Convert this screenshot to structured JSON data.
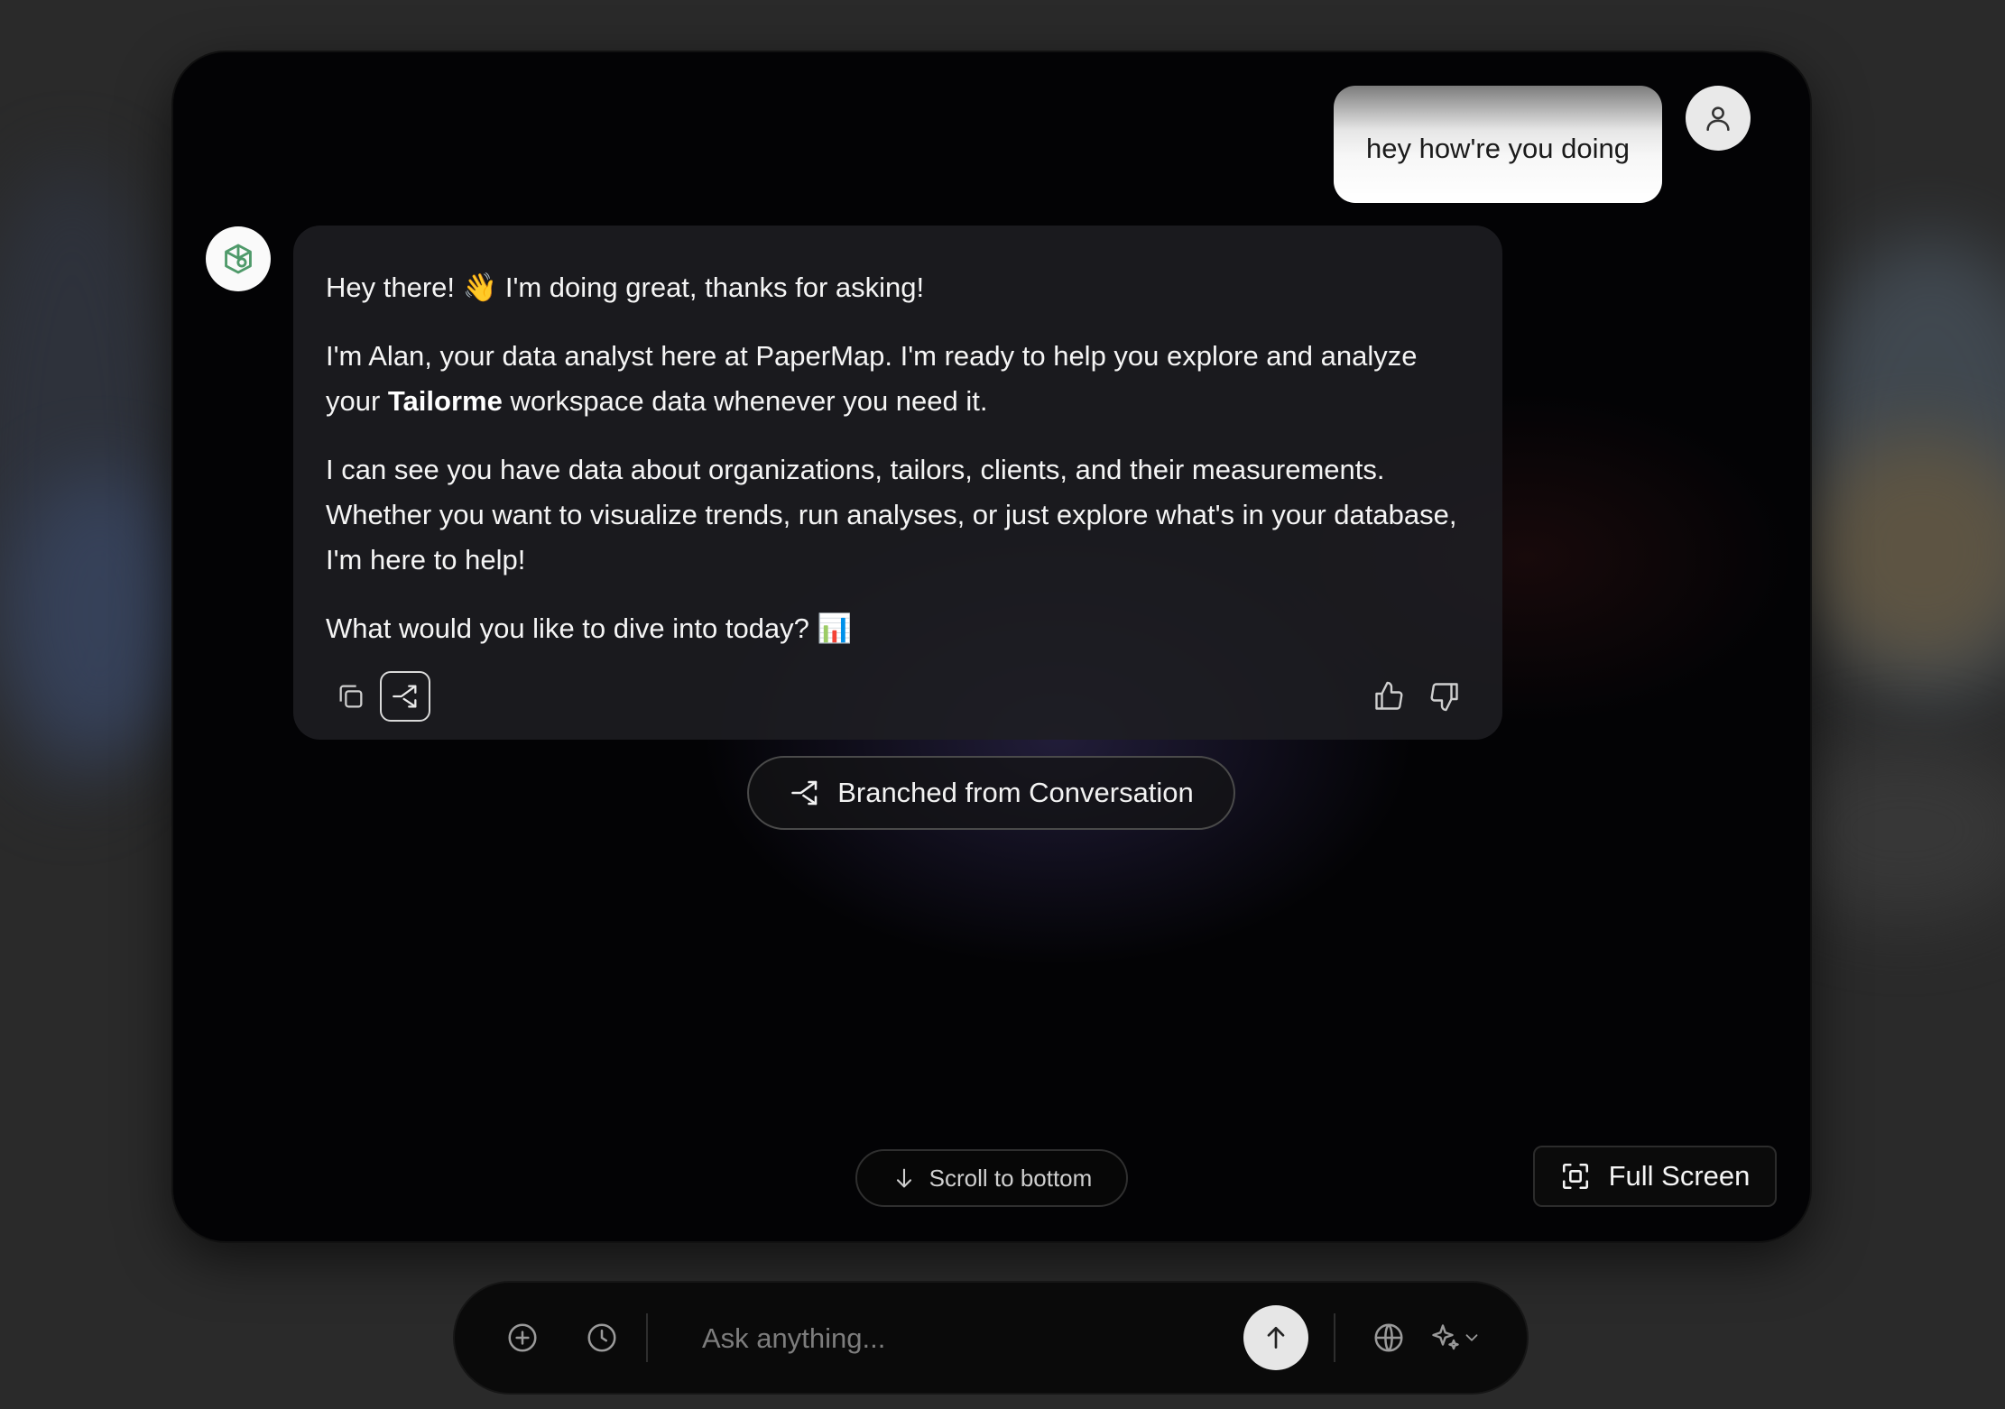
{
  "chat": {
    "user_message": "hey how're you doing",
    "bot_message": {
      "p1": "Hey there! 👋 I'm doing great, thanks for asking!",
      "p2_before": "I'm Alan, your data analyst here at PaperMap. I'm ready to help you explore and analyze your ",
      "p2_bold": "Tailorme",
      "p2_after": " workspace data whenever you need it.",
      "p3": "I can see you have data about organizations, tailors, clients, and their measurements. Whether you want to visualize trends, run analyses, or just explore what's in your database, I'm here to help!",
      "p4": "What would you like to dive into today? 📊"
    },
    "actions": {
      "copy_icon": "copy-icon",
      "branch_icon": "branch-icon",
      "thumbs_up_icon": "thumbs-up-icon",
      "thumbs_down_icon": "thumbs-down-icon"
    },
    "branch_pill_label": "Branched from Conversation",
    "scroll_label": "Scroll to bottom",
    "fullscreen_label": "Full Screen"
  },
  "composer": {
    "placeholder": "Ask anything...",
    "icons": [
      "plus-circle-icon",
      "clock-icon",
      "send-arrow-icon",
      "globe-icon",
      "sparkle-icon",
      "chevron-down-icon"
    ]
  },
  "colors": {
    "panel_bg": "#030305",
    "bubble_bg": "#1e1e22",
    "user_bubble": "#ffffff",
    "accent_green": "#4f9a6a"
  }
}
